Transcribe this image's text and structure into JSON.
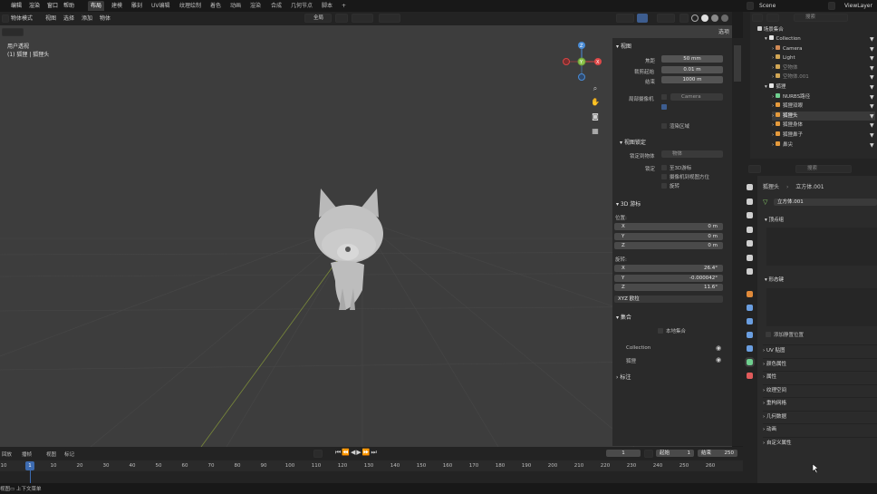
{
  "topbar": {
    "menus": [
      "编辑",
      "渲染",
      "窗口",
      "帮助"
    ],
    "workspaces": [
      "布局",
      "建模",
      "雕刻",
      "UV编辑",
      "纹理绘制",
      "着色",
      "动画",
      "渲染",
      "合成",
      "几何节点",
      "脚本"
    ],
    "active_workspace": "布局",
    "plus": "+",
    "scene_label": "Scene",
    "viewlayer_label": "ViewLayer"
  },
  "viewport_header": {
    "mode": "物体模式",
    "menus": [
      "视图",
      "选择",
      "添加",
      "物体"
    ],
    "transform": "全局",
    "options_label": "选项"
  },
  "viewport": {
    "view_name": "用户透视",
    "object_info": "(1) 狐狸 | 狐狸头",
    "axis_x": "X",
    "axis_y": "Y",
    "axis_z": "Z"
  },
  "npanel": {
    "view_section": "视图",
    "focal_label": "焦距",
    "focal_value": "50 mm",
    "clip_start_label": "裁剪起始",
    "clip_start_value": "0.01 m",
    "clip_end_label": "结束",
    "clip_end_value": "1000 m",
    "local_camera_label": "局部摄像机",
    "local_camera_value": "Camera",
    "render_region": "渲染区域",
    "view_lock_section": "视图锁定",
    "lock_object_label": "锁定到物体",
    "lock_object_value": "物体",
    "lock_label": "锁定",
    "lock_3d_cursor": "至3D游标",
    "lock_camera": "摄像机到视图方位",
    "lock_rotation": "旋转",
    "cursor_section": "3D 游标",
    "location_label": "位置:",
    "rotation_label": "旋转:",
    "loc": [
      {
        "axis": "X",
        "value": "0 m"
      },
      {
        "axis": "Y",
        "value": "0 m"
      },
      {
        "axis": "Z",
        "value": "0 m"
      }
    ],
    "rot": [
      {
        "axis": "X",
        "value": "26.4°"
      },
      {
        "axis": "Y",
        "value": "-0.000042°"
      },
      {
        "axis": "Z",
        "value": "11.6°"
      }
    ],
    "rotation_mode": "XYZ 欧拉",
    "collection_section": "集合",
    "local_collection": "本地集合",
    "collections": [
      "Collection",
      "狐狸"
    ],
    "annotation_section": "标注"
  },
  "outliner": {
    "search_placeholder": "搜索",
    "root": "场景集合",
    "items": [
      {
        "label": "Collection",
        "indent": 1,
        "color": "#cfcfcf"
      },
      {
        "label": "Camera",
        "indent": 2,
        "color": "#cfcfcf"
      },
      {
        "label": "Light",
        "indent": 2,
        "color": "#cfcfcf"
      },
      {
        "label": "空物体",
        "indent": 2,
        "color": "#888888"
      },
      {
        "label": "空物体.001",
        "indent": 2,
        "color": "#888888"
      },
      {
        "label": "狐狸",
        "indent": 1,
        "color": "#cfcfcf"
      },
      {
        "label": "NURBS路径",
        "indent": 2,
        "color": "#cfcfcf"
      },
      {
        "label": "狐狸双眼",
        "indent": 2,
        "color": "#cfcfcf"
      },
      {
        "label": "狐狸头",
        "indent": 2,
        "color": "#ffffff"
      },
      {
        "label": "狐狸身体",
        "indent": 2,
        "color": "#cfcfcf"
      },
      {
        "label": "狐狸鼻子",
        "indent": 2,
        "color": "#cfcfcf"
      },
      {
        "label": "鼻尖",
        "indent": 2,
        "color": "#cfcfcf"
      }
    ]
  },
  "properties": {
    "search_placeholder": "搜索",
    "breadcrumb_object": "狐狸头",
    "breadcrumb_mesh": "立方体.001",
    "mesh_name": "立方体.001",
    "vertex_groups": "顶点组",
    "shape_keys": "形态键",
    "add_rest": "添加静置位置",
    "sections": [
      "UV 贴图",
      "颜色属性",
      "属性",
      "纹理空间",
      "重构网格",
      "几何数据",
      "动画",
      "自定义属性"
    ]
  },
  "timeline": {
    "menus": [
      "回放",
      "播帧",
      "视图",
      "标记"
    ],
    "current_frame": "1",
    "start_label": "起始",
    "start_value": "1",
    "end_label": "结束",
    "end_value": "250",
    "ticks": [
      "10",
      "20",
      "30",
      "40",
      "50",
      "60",
      "70",
      "80",
      "90",
      "100",
      "110",
      "120",
      "130",
      "140",
      "150",
      "160",
      "170",
      "180",
      "190",
      "200",
      "210",
      "220",
      "230",
      "240",
      "250",
      "260"
    ],
    "playhead": "1",
    "first_tick": "10"
  },
  "statusbar": {
    "text": "上下文菜单",
    "left": "视图"
  }
}
